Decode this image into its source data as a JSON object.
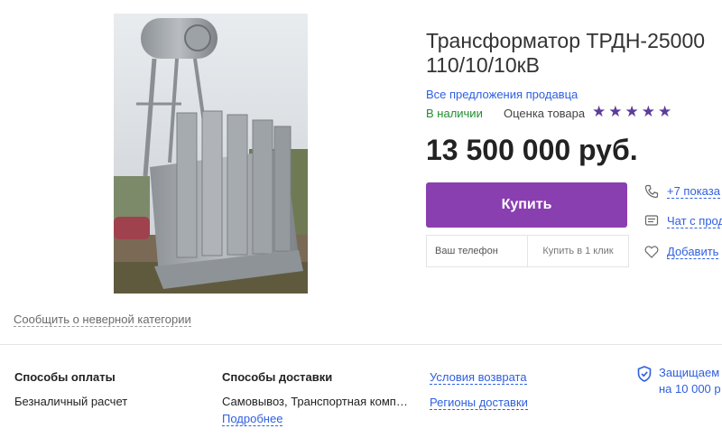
{
  "product": {
    "title_line1": "Трансформатор ТРДН-25000",
    "title_line2": "110/10/10кВ",
    "seller_link": "Все предложения продавца",
    "stock_status": "В наличии",
    "rating_label": "Оценка товара",
    "rating_stars": "★★★★★",
    "rating_value": 5,
    "price": "13 500 000 руб.",
    "report_link": "Сообщить о неверной категории"
  },
  "actions": {
    "buy_label": "Купить",
    "phone_placeholder": "Ваш телефон",
    "one_click_label": "Купить в 1 клик"
  },
  "side": {
    "phone_link": "+7 показа",
    "chat_link": "Чат с прод",
    "favorite_link": "Добавить"
  },
  "info": {
    "payment_title": "Способы оплаты",
    "payment_value": "Безналичный расчет",
    "delivery_title": "Способы доставки",
    "delivery_value": "Самовывоз, Транспортная комп…",
    "delivery_more": "Подробнее",
    "return_link": "Условия возврата",
    "regions_link": "Регионы доставки",
    "protection_line1": "Защищаем",
    "protection_line2": "на 10 000 р"
  },
  "colors": {
    "accent": "#8a3fb0",
    "link": "#2e5fe0",
    "in_stock": "#1f8f2e",
    "stars": "#5b3d9c"
  }
}
